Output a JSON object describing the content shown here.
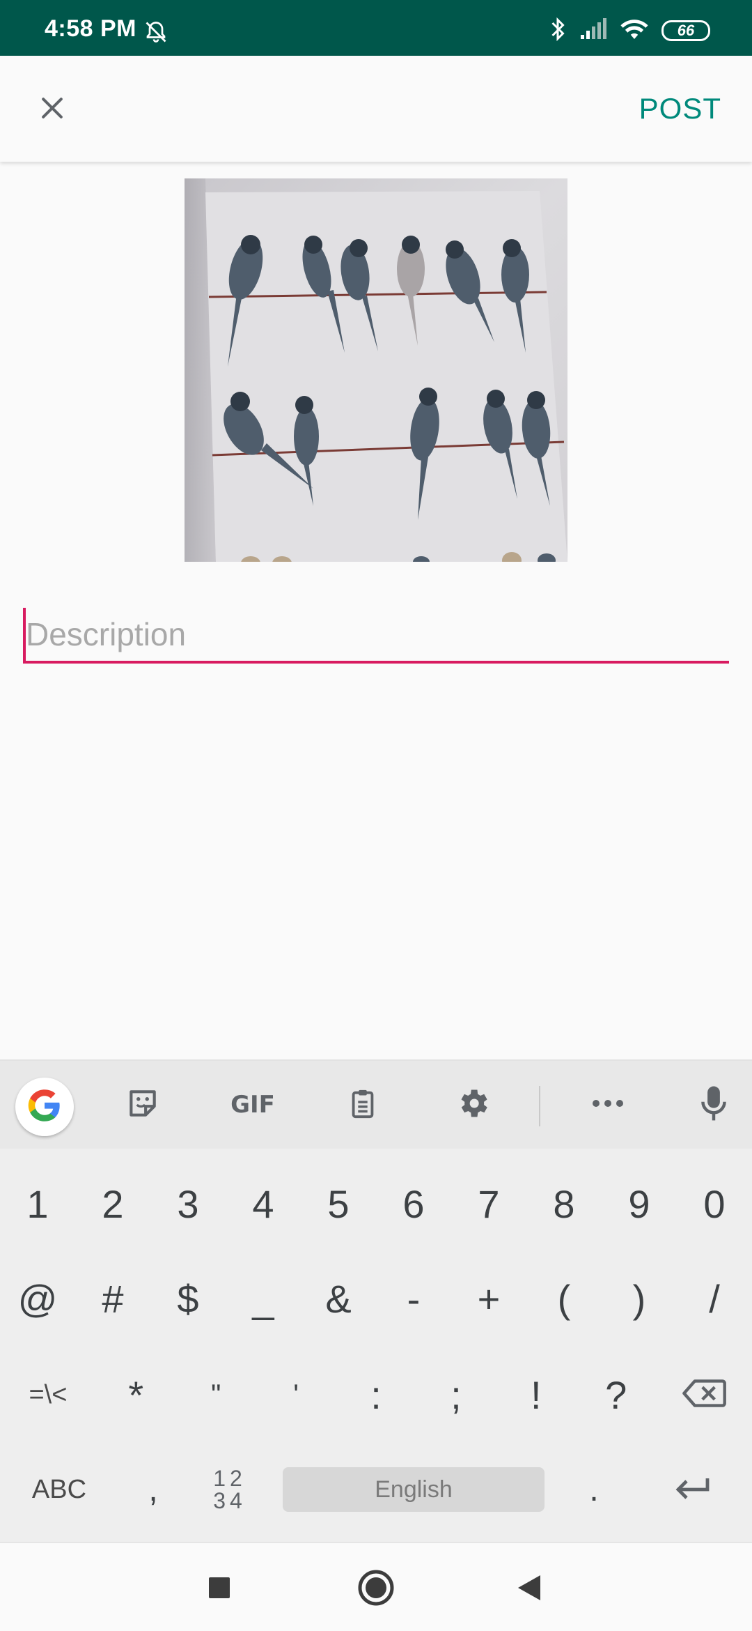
{
  "status_bar": {
    "time": "4:58 PM",
    "battery": "66",
    "icons": [
      "bell-off-icon",
      "bluetooth-icon",
      "signal-icon",
      "wifi-icon",
      "battery-icon"
    ]
  },
  "app_bar": {
    "close_icon": "close-icon",
    "post_label": "POST"
  },
  "photo": {
    "description": "budgies-painting"
  },
  "description_field": {
    "placeholder": "Description",
    "value": ""
  },
  "keyboard": {
    "toolbar": [
      "google-icon",
      "sticker-icon",
      "GIF",
      "clipboard-icon",
      "gear-icon",
      "more-icon",
      "mic-icon"
    ],
    "gif_label": "GIF",
    "row1": [
      "1",
      "2",
      "3",
      "4",
      "5",
      "6",
      "7",
      "8",
      "9",
      "0"
    ],
    "row2": [
      "@",
      "#",
      "$",
      "_",
      "&",
      "-",
      "+",
      "(",
      ")",
      "/"
    ],
    "row3": [
      "=\\<",
      "*",
      "\"",
      "'",
      ":",
      ";",
      "!",
      "?"
    ],
    "row4": {
      "abc": "ABC",
      "comma": ",",
      "numpad_top": "12",
      "numpad_bottom": "34",
      "space": "English",
      "period": "."
    }
  },
  "nav_bar": {
    "icons": [
      "recents-square-icon",
      "home-circle-icon",
      "back-triangle-icon"
    ]
  },
  "colors": {
    "status_bar": "#00574b",
    "accent_post": "#00897b",
    "input_accent": "#d81b60"
  }
}
